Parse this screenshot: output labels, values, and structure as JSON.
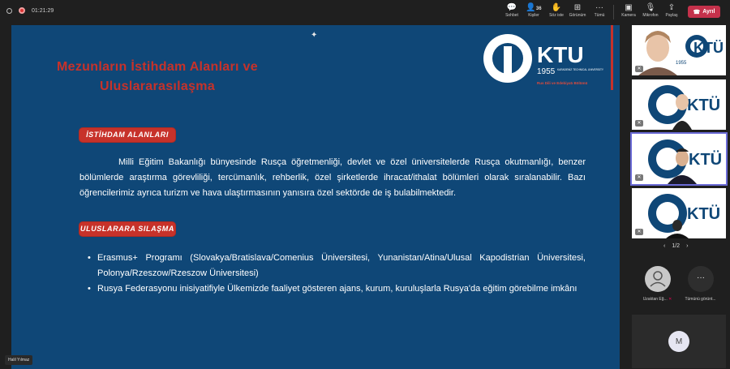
{
  "meeting": {
    "timer": "01:21:29"
  },
  "toolbar": [
    {
      "label": "Sohbet",
      "icon": "chat-icon"
    },
    {
      "label": "Kişiler",
      "icon": "people-icon",
      "count": "36"
    },
    {
      "label": "Söz iste",
      "icon": "raise-hand-icon"
    },
    {
      "label": "Görünüm",
      "icon": "view-icon"
    },
    {
      "label": "Tümü",
      "icon": "more-icon"
    },
    {
      "label": "Kamera",
      "icon": "camera-icon"
    },
    {
      "label": "Mikrofon",
      "icon": "mic-icon"
    },
    {
      "label": "Paylaş",
      "icon": "share-icon"
    }
  ],
  "leave_label": "Ayrıl",
  "slide": {
    "title": "Mezunların İstihdam Alanları ve Uluslararasılaşma",
    "logo_text": "KTU",
    "logo_year": "1955",
    "logo_sub": "KARADENİZ TECHNICAL UNIVERSITY",
    "logo_dept": "Rus Dili ve Edebiyatı Bölümü",
    "badge1": "İSTİHDAM ALANLARI",
    "paragraph": "Milli Eğitim Bakanlığı bünyesinde Rusça öğretmenliği, devlet ve özel üniversitelerde Rusça okutmanlığı, benzer bölümlerde araştırma görevliliği, tercümanlık, rehberlik, özel şirketlerde ihracat/ithalat bölümleri olarak sıralanabilir. Bazı öğrencilerimiz ayrıca turizm ve hava ulaştırmasının yanısıra özel sektörde de iş bulabilmektedir.",
    "badge2": "ULUSLARARA SILAŞMA",
    "bullets": [
      "Erasmus+ Programı (Slovakya/Bratislava/Comenius Üniversitesi, Yunanistan/Atina/Ulusal Kapodistrian Üniversitesi, Polonya/Rzeszow/Rzeszow Üniversitesi)",
      "Rusya Federasyonu inisiyatifiyle Ülkemizde faaliyet gösteren ajans, kurum, kuruluşlarla Rusya'da eğitim görebilme imkânı"
    ]
  },
  "presenter_name": "Halil Yılmaz",
  "tile_logo_text": "KTÜ",
  "tile_logo_year": "1955",
  "pager": "1/2",
  "participants": [
    {
      "label": "Uzaktan Eğ...",
      "icon": "person-icon"
    },
    {
      "label": "Tümünü görünt...",
      "icon": "more-icon"
    }
  ],
  "avatar_initial": "M",
  "colors": {
    "slide_bg": "#0f4777",
    "accent_red": "#c7322a",
    "leave": "#c4314b"
  }
}
